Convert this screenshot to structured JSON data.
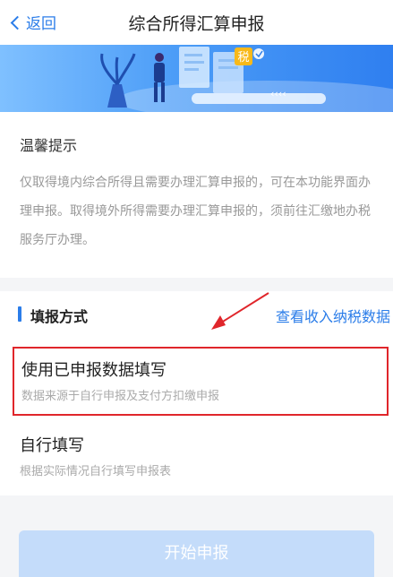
{
  "nav": {
    "back_label": "返回",
    "title": "综合所得汇算申报"
  },
  "banner": {
    "tax_char": "税",
    "arrows": "‹‹‹‹"
  },
  "tip": {
    "title": "温馨提示",
    "body": "仅取得境内综合所得且需要办理汇算申报的，可在本功能界面办理申报。取得境外所得需要办理汇算申报的，须前往汇缴地办税服务厅办理。"
  },
  "method": {
    "section_title": "填报方式",
    "view_link": "查看收入纳税数据",
    "options": [
      {
        "title": "使用已申报数据填写",
        "desc": "数据来源于自行申报及支付方扣缴申报"
      },
      {
        "title": "自行填写",
        "desc": "根据实际情况自行填写申报表"
      }
    ]
  },
  "start_button": "开始申报",
  "colors": {
    "accent": "#2b7de9",
    "highlight": "#e0262b",
    "button_disabled": "#c4dcfa"
  }
}
